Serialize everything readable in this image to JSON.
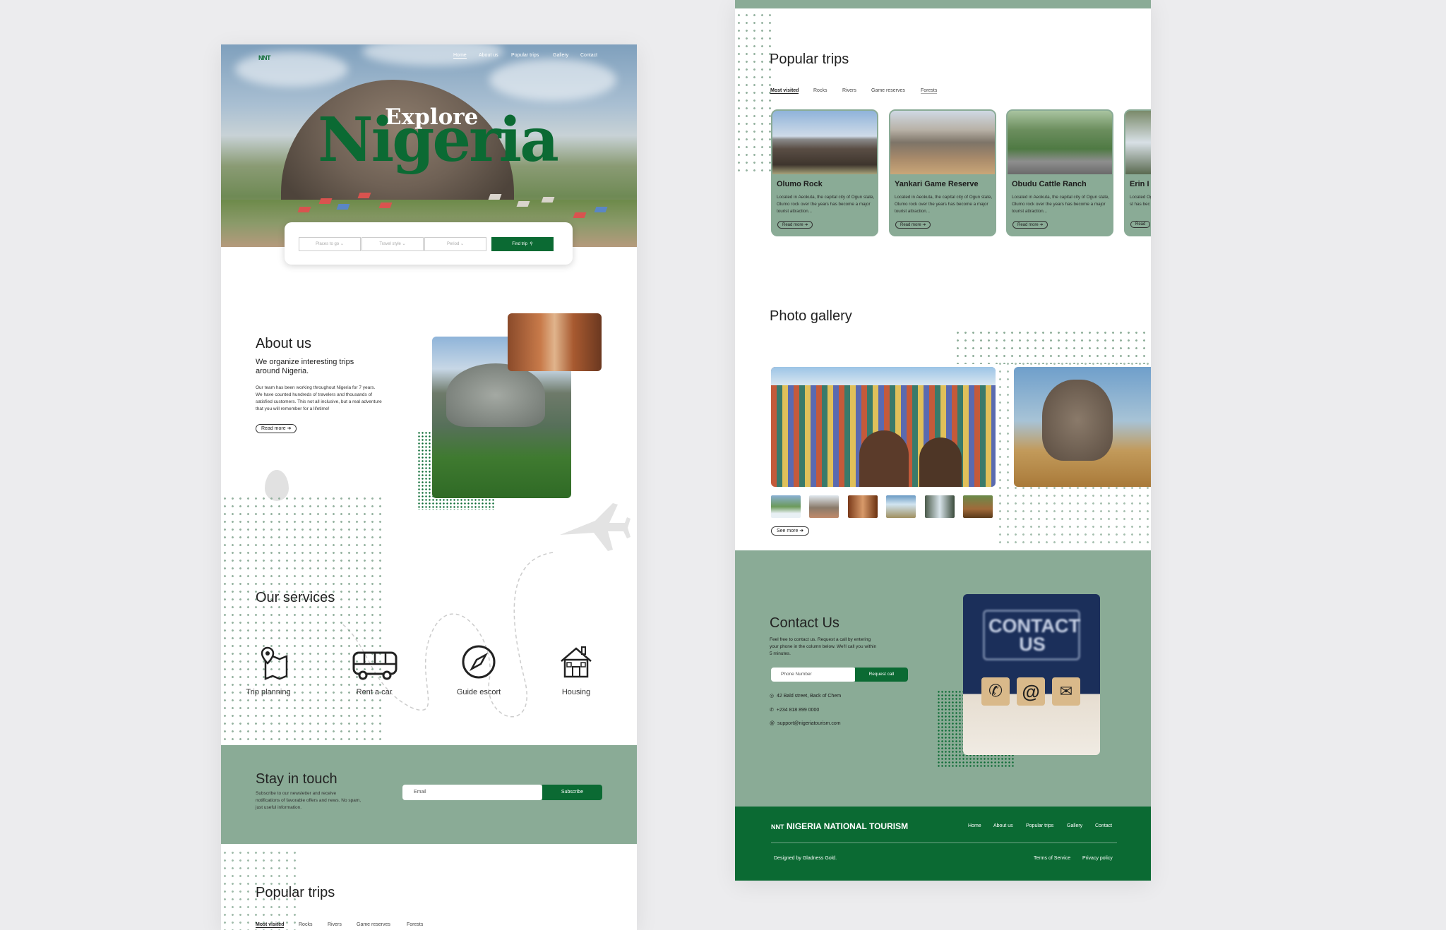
{
  "left": {
    "logo": "NNT",
    "nav": [
      "Home",
      "About us",
      "Popular trips",
      "Gallery",
      "Contact"
    ],
    "hero": {
      "title_small": "Explore",
      "title_big": "Nigeria"
    },
    "search": {
      "places": "Places to go",
      "travel_style": "Travel style",
      "period": "Period",
      "find_button": "Find trip"
    },
    "about": {
      "title": "About us",
      "subtitle": "We organize interesting trips around Nigeria.",
      "body": "Our team has been working throughout Nigeria for 7 years. We have counted hundreds of travelers and thousands of satisfied customers. This not all inclusive, but a real adventure that you will remember for a lifetime!",
      "read_more": "Read more"
    },
    "services": {
      "title": "Our services",
      "items": [
        {
          "label": "Trip planning",
          "icon": "map-pin-icon"
        },
        {
          "label": "Rent a car",
          "icon": "bus-icon"
        },
        {
          "label": "Guide escort",
          "icon": "compass-icon"
        },
        {
          "label": "Housing",
          "icon": "house-icon"
        }
      ]
    },
    "stay": {
      "title": "Stay in touch",
      "body": "Subscribe to our newsletter and receive notifications of favorable offers and news. No spam, just useful information.",
      "email_placeholder": "Email",
      "subscribe": "Subscribe"
    },
    "popular": {
      "title": "Popular trips",
      "tabs": [
        "Most visited",
        "Rocks",
        "Rivers",
        "Game reserves",
        "Forests"
      ]
    }
  },
  "right": {
    "popular": {
      "title": "Popular trips",
      "tabs": [
        "Most visited",
        "Rocks",
        "Rivers",
        "Game reserves",
        "Forests"
      ],
      "cards": [
        {
          "title": "Olumo Rock",
          "desc": "Located in Aeokuta, the capital city of Ogun state, Olumo rock over the years has become a major tourist attraction...",
          "read_more": "Read more"
        },
        {
          "title": "Yankari Game Reserve",
          "desc": "Located in Aeokuta, the capital city of Ogun state, Olumo rock over the years has become a major tourist attraction...",
          "read_more": "Read more"
        },
        {
          "title": "Obudu Cattle Ranch",
          "desc": "Located in Aeokuta, the capital city of Ogun state, Olumo rock over the years has become a major tourist attraction...",
          "read_more": "Read more"
        },
        {
          "title": "Erin I",
          "desc": "Located Ogun st has bec",
          "read_more": "Read"
        }
      ]
    },
    "gallery": {
      "title": "Photo gallery",
      "see_more": "See more"
    },
    "contact": {
      "title": "Contact Us",
      "body": "Feel free to contact us. Request a call by entering your phone in the column below. We'll call you within 5 minutes.",
      "phone_placeholder": "Phone Number",
      "request_button": "Request call",
      "address": "42 Bald street, Back of Chem",
      "phone": "+234 818 899 0000",
      "email": "support@nigeriatourism.com",
      "sign_text": "CONTACT US"
    },
    "footer": {
      "brand": "NIGERIA NATIONAL TOURISM",
      "logo": "NNT",
      "links": [
        "Home",
        "About us",
        "Popular trips",
        "Gallery",
        "Contact"
      ],
      "credit": "Designed by Gladness Gold.",
      "terms": "Terms of Service",
      "privacy": "Privacy policy"
    }
  },
  "colors": {
    "primary_green": "#0b6a33",
    "sage": "#8aab96",
    "background": "#ececee"
  }
}
